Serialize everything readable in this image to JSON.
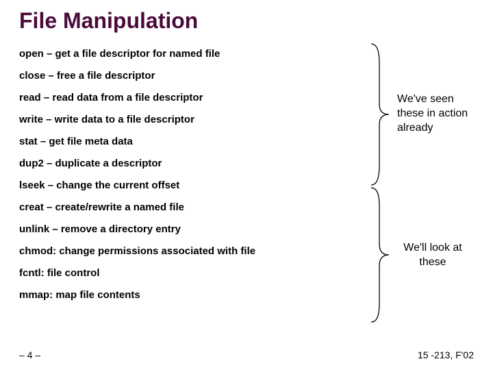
{
  "title": "File Manipulation",
  "syscalls": [
    "open – get a file descriptor for named file",
    "close – free a file descriptor",
    "read – read data from a file descriptor",
    "write – write data to a file descriptor",
    "stat – get file meta data",
    "dup2 – duplicate a descriptor",
    "lseek – change the current offset",
    "creat – create/rewrite a named file",
    "unlink – remove a directory entry",
    "chmod: change permissions associated with file",
    "fcntl: file control",
    "mmap: map file contents"
  ],
  "annotation1_line1": "We've seen",
  "annotation1_line2": "these in action",
  "annotation1_line3": "already",
  "annotation2_line1": "We'll look at",
  "annotation2_line2": "these",
  "page_number": "– 4 –",
  "course": "15 -213, F'02"
}
